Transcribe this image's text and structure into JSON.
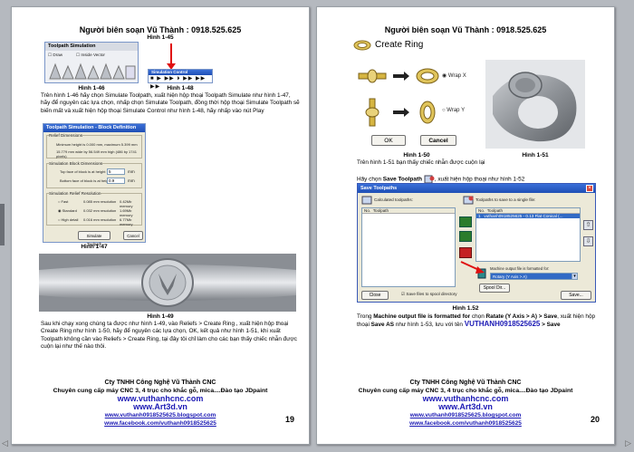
{
  "left": {
    "header": "Người biên soạn Vũ Thành : 0918.525.625",
    "fig145": "Hình 1-45",
    "fig146": "Hình 1-46",
    "fig148": "Hình 1-48",
    "fig147": "Hình 1-47",
    "fig149": "Hình 1-49",
    "page_number": "19",
    "toolpath_sim": {
      "title": "Toolpath Simulation",
      "draw": "Draw",
      "inside": "Inside Vector"
    },
    "sim_control": {
      "title": "Simulation Control"
    },
    "block_def": {
      "title": "Toolpath Simulation - Block Definition",
      "relief_dims": "Relief Dimensions",
      "min_height": "Minimum height is 0.000 mm, maximum 5.399 mm",
      "res_line": "15.779 mm wide by 56.549 mm high (486 by 1741 pixels)",
      "sim_block": "Simulation Block Dimensions",
      "top_face": "Top face of block is at height",
      "top_val": "5",
      "bottom_face": "Bottom face of block is at height",
      "bottom_val": "0.9",
      "mm": "mm",
      "relief_res": "Simulation Relief Resolution",
      "fast": "Fast",
      "fast_res": "0.085 mm resolution",
      "fast_mem": "0.42Mb memory",
      "standard": "Standard",
      "std_res": "0.032 mm resolution",
      "std_mem": "1.69Mb memory",
      "high": "High detail",
      "high_res": "0.016 mm resolution",
      "high_mem": "6.77Mb memory",
      "simulate_btn": "Simulate Toolpath",
      "cancel_btn": "Cancel"
    },
    "para1": "Trên hình 1-46 hãy chọn Simulate Toolpath, xuất hiện hộp thoại Toolpath Simulate như hình 1-47, hãy để nguyên các lựa chọn, nhấp chọn Simulate Toolpath, đồng thời hộp thoại Simulate Toolpath sẽ biến mất và xuất hiện hộp thoại Simulate Control như hình 1-48, hãy nhấp vào nút Play",
    "para2": "Sau khi chạy xong chúng ta được như hình 1-49, vào Reliefs > Create Ring , xuất hiện hộp thoại Create Ring như hình 1-50, hãy để nguyên các lựa chọn, OK, kết quả như hình 1-51, khi xuất Toolpath không cần vào Reliefs > Create Ring, tại đây tôi chỉ làm cho các bạn thấy chiếc nhẫn được cuộn lại như thế nào thôi."
  },
  "right": {
    "header": "Người biên soạn Vũ Thành : 0918.525.625",
    "create_ring": {
      "title": "Create Ring",
      "wrap_x": "Wrap X",
      "wrap_y": "Wrap Y",
      "ok": "OK",
      "cancel": "Cancel"
    },
    "fig150": "Hình 1-50",
    "fig151": "Hình 1-51",
    "fig152": "Hình 1.52",
    "line151": "Trên hình 1-51 bạn thấy chiếc nhẫn được cuộn lại",
    "line_save_a": "Hãy chọn ",
    "line_save_b": "Save Toolpath",
    "line_save_c": ", xuất hiện hộp thoại như hình 1-52",
    "save_dialog": {
      "title": "Save Toolpaths",
      "calculated": "Calculated toolpaths:",
      "to_save": "Toolpaths to save to a single file:",
      "col_no": "No.",
      "col_toolpath": "Toolpath",
      "row_no": "1",
      "row_name": "vuthanh0918525625 - 0.13 Flat Conical (...",
      "machine_label": "Machine output file is formatted for:",
      "machine_value": "Rotary (Y Axis > A)",
      "spool": "Spool Dir...",
      "save_spool": "Save files to spool directory",
      "close": "Close",
      "save": "Save..."
    },
    "para_a": "Trong ",
    "para_b": "Machine output file is formatted for",
    "para_c": " chọn ",
    "para_d": "Ratate (Y Axis > A) > Save",
    "para_e": ", xuất hiện hộp thoại ",
    "para_f": "Save AS",
    "para_g": " như hình 1-53, lưu với tên ",
    "para_h": "VUTHANH0918525625",
    "para_i": " > Save",
    "page_number": "20"
  },
  "footer": {
    "company": "Cty TNHH Công Nghệ Vũ Thành CNC",
    "line2": "Chuyên cung cấp máy CNC 3, 4 trục cho khắc gỗ, mica....Đào tạo JDpaint",
    "web1": "www.vuthanhcnc.com",
    "web2": "www.Art3d.vn",
    "blog": "www.vuthanh0918525625.blogspot.com",
    "facebook": "www.facebook.com/vuthanh0918525625"
  }
}
